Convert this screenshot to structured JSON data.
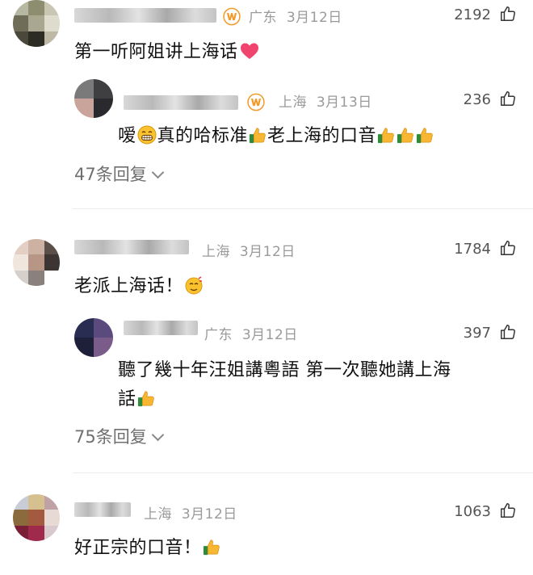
{
  "comments": [
    {
      "region": "广东",
      "date": "3月12日",
      "likes": "2192",
      "vip": true,
      "text": "第一听阿姐讲上海话",
      "emoji": "heart-emoji",
      "reply": {
        "region": "上海",
        "date": "3月13日",
        "likes": "236",
        "vip": true,
        "text_parts": [
          "嗳",
          "真的哈标准",
          "老上海的口音"
        ],
        "emojis": [
          "grin-emoji",
          "thumbs-up-emoji",
          "thumbs-up-emoji",
          "thumbs-up-emoji",
          "thumbs-up-emoji"
        ]
      },
      "replies_label": "47条回复"
    },
    {
      "region": "上海",
      "date": "3月12日",
      "likes": "1784",
      "text": "老派上海话！",
      "emoji": "666-face-emoji",
      "reply": {
        "region": "广东",
        "date": "3月12日",
        "likes": "397",
        "text_line1": "聽了幾十年汪姐講粵語 第一次聽她講上海",
        "text_line2": "話",
        "emojis": [
          "thumbs-up-emoji"
        ]
      },
      "replies_label": "75条回复"
    },
    {
      "region": "上海",
      "date": "3月12日",
      "likes": "1063",
      "text": "好正宗的口音！",
      "emoji": "thumbs-up-emoji"
    }
  ],
  "icons": {
    "like": "thumbs-up-outline-icon",
    "vip": "vip-badge-icon",
    "expand": "chevron-down-icon"
  },
  "colors": {
    "meta_text": "#9a9a9a",
    "vip_badge": "#f29b2c",
    "heart": "#f0436e"
  }
}
